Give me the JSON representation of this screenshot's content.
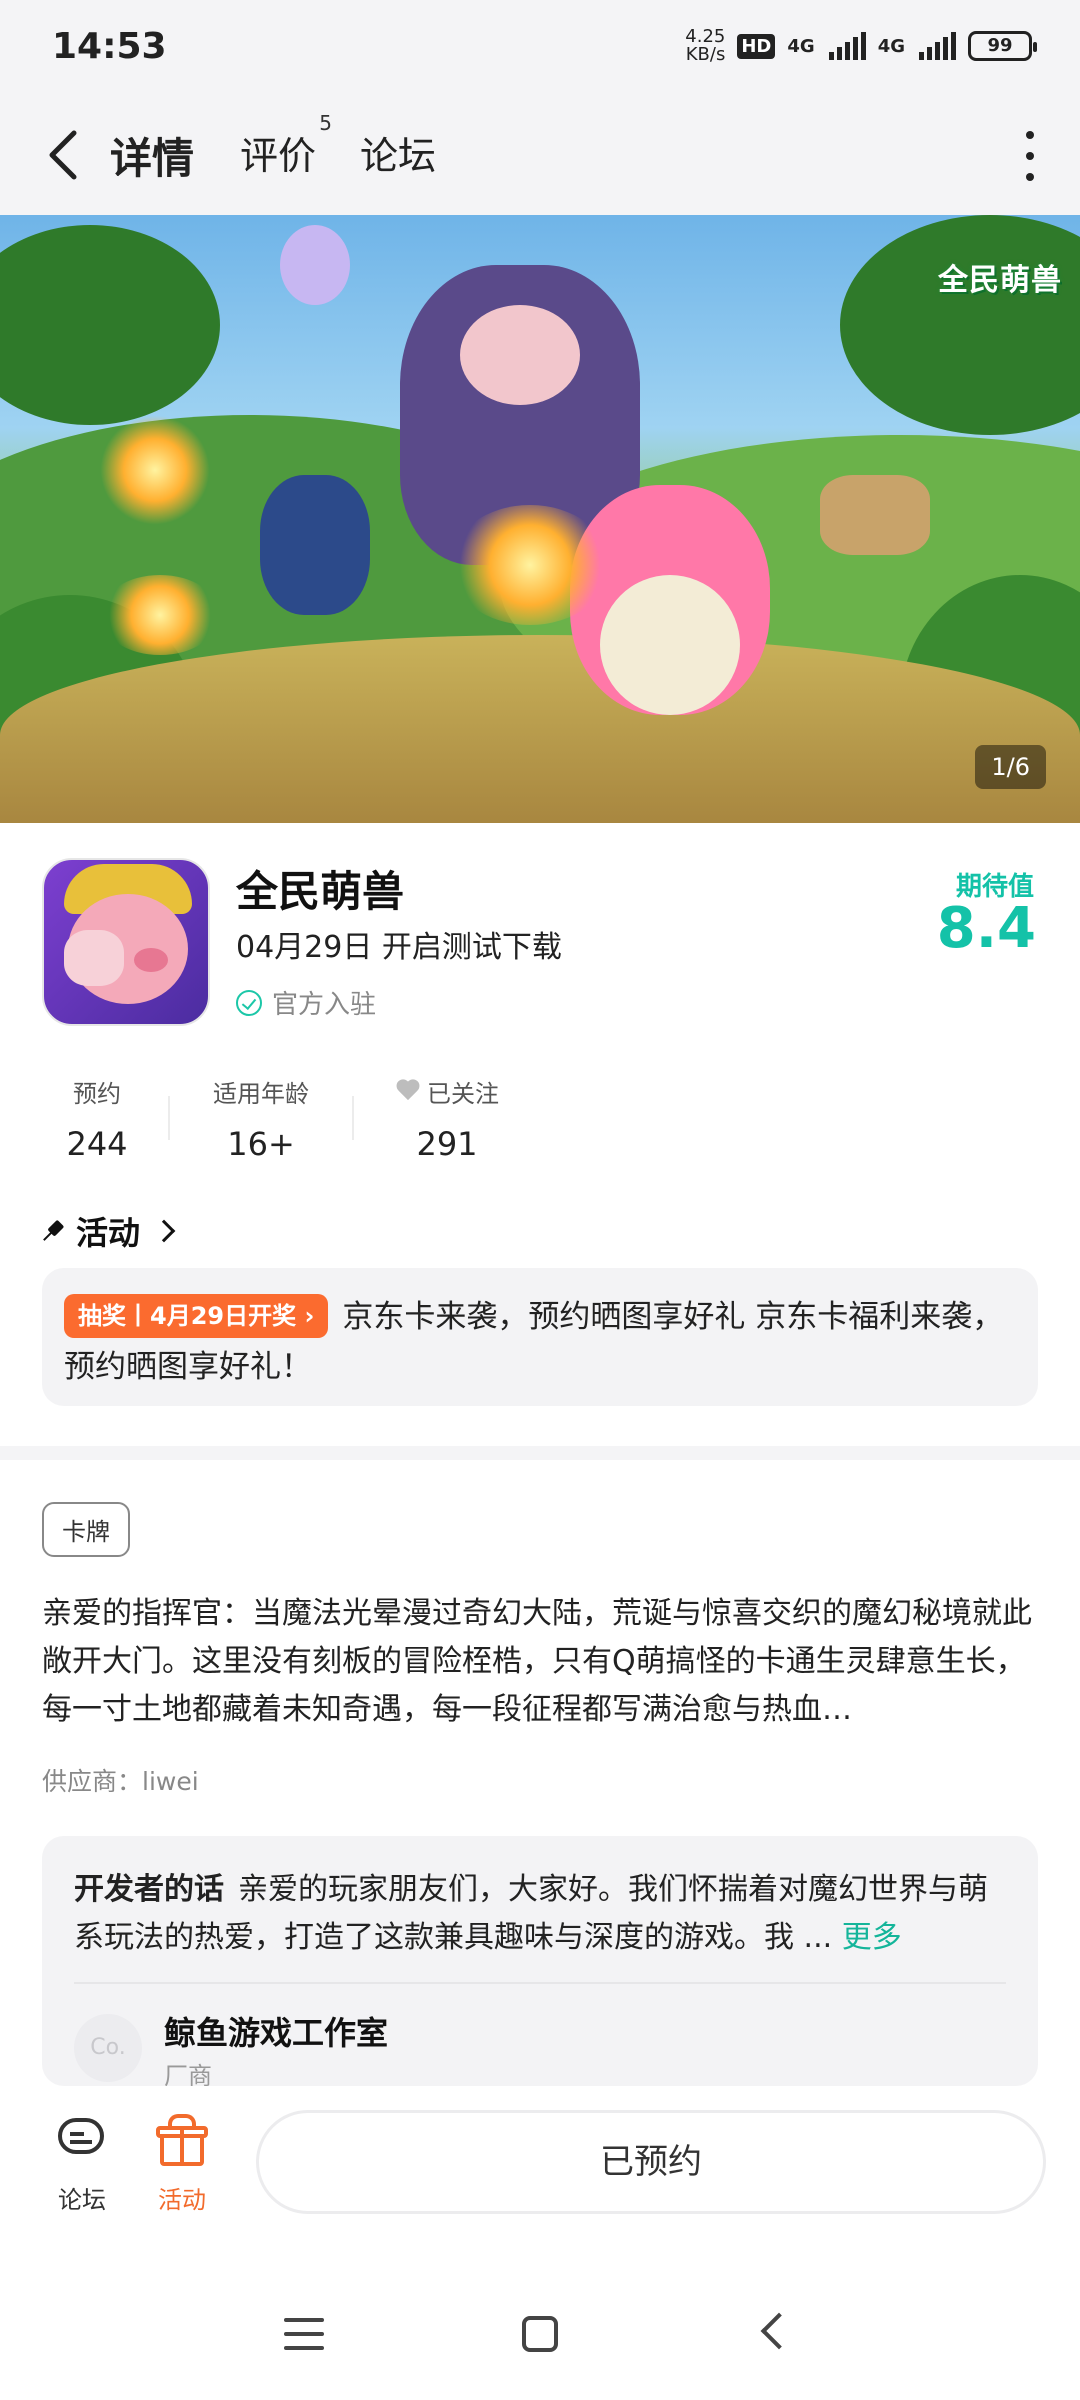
{
  "status_bar": {
    "time": "14:53",
    "net_speed_value": "4.25",
    "net_speed_unit": "KB/s",
    "hd_label": "HD",
    "signal1_label": "4G",
    "signal2_label": "4G",
    "battery": "99"
  },
  "nav": {
    "tabs": [
      {
        "label": "详情"
      },
      {
        "label": "评价",
        "badge": "5"
      },
      {
        "label": "论坛"
      }
    ]
  },
  "hero": {
    "logo_text": "全民萌兽",
    "counter": "1/6"
  },
  "game": {
    "name": "全民萌兽",
    "test_date": "04月29日 开启测试下载",
    "official_label": "官方入驻",
    "expect_label": "期待值",
    "expect_score": "8.4"
  },
  "stats": [
    {
      "label": "预约",
      "value": "244"
    },
    {
      "label": "适用年龄",
      "value": "16+"
    },
    {
      "label": "已关注",
      "value": "291"
    }
  ],
  "activity": {
    "heading": "活动",
    "tag": "抽奖丨4月29日开奖 ›",
    "text": "京东卡来袭，预约晒图享好礼 京东卡福利来袭，预约晒图享好礼！"
  },
  "genre_tag": "卡牌",
  "description": "亲爱的指挥官：当魔法光晕漫过奇幻大陆，荒诞与惊喜交织的魔幻秘境就此敞开大门。这里没有刻板的冒险桎梏，只有Q萌搞怪的卡通生灵肆意生长，每一寸土地都藏着未知奇遇，每一段征程都写满治愈与热血…",
  "supplier": "供应商：liwei",
  "developer": {
    "lead": "开发者的话",
    "text": "亲爱的玩家朋友们，大家好。我们怀揣着对魔幻世界与萌系玩法的热爱，打造了这款兼具趣味与深度的游戏。我 ...",
    "more": "更多",
    "avatar_text": "Co.",
    "name": "鲸鱼游戏工作室",
    "role": "厂商"
  },
  "bottom_bar": {
    "forum_label": "论坛",
    "activity_label": "活动",
    "reserve_button": "已预约"
  },
  "colors": {
    "accent": "#14c2a8",
    "orange": "#f26b2c"
  }
}
